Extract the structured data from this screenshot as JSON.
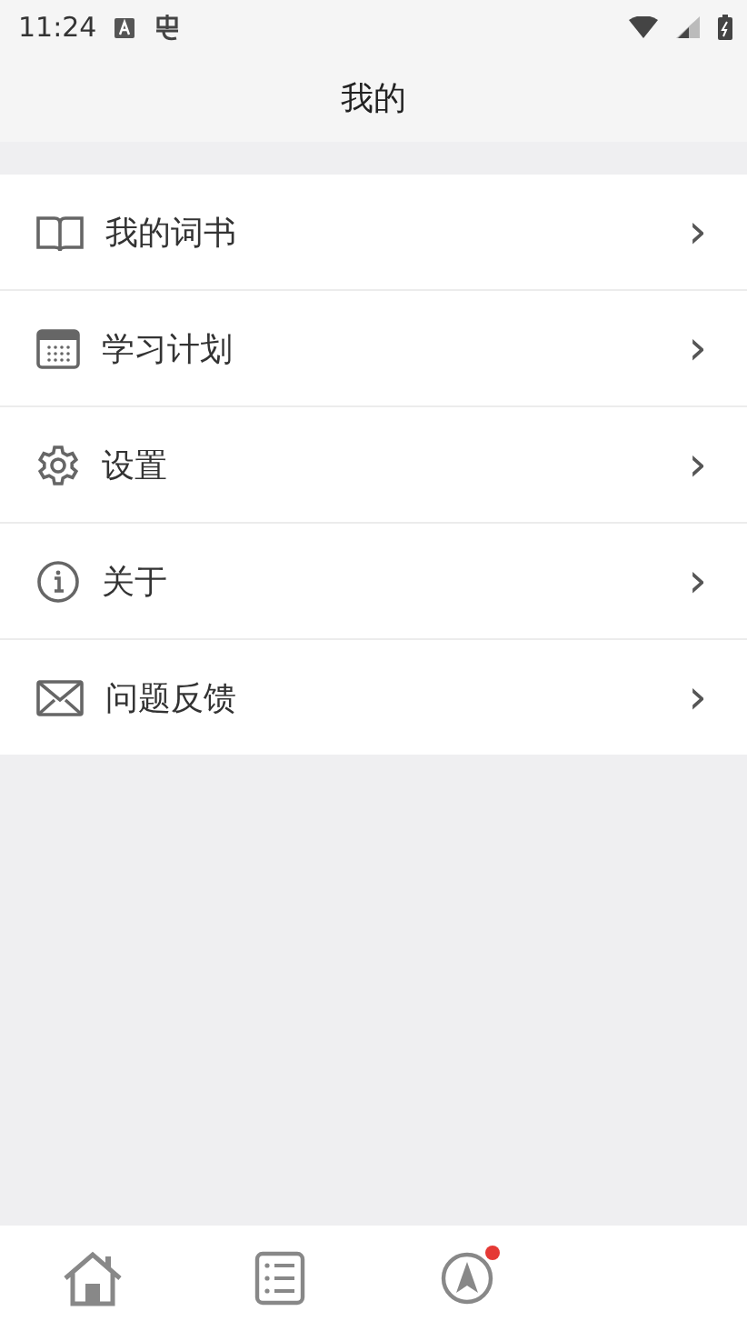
{
  "status_bar": {
    "time": "11:24"
  },
  "header": {
    "title": "我的"
  },
  "menu": [
    {
      "kind": "book",
      "label": "我的词书",
      "chevron": "›"
    },
    {
      "kind": "calendar",
      "label": "学习计划",
      "chevron": "›"
    },
    {
      "kind": "gear",
      "label": "设置",
      "chevron": "›"
    },
    {
      "kind": "info",
      "label": "关于",
      "chevron": "›"
    },
    {
      "kind": "mail",
      "label": "问题反馈",
      "chevron": "›"
    }
  ],
  "tab_bar": [
    {
      "kind": "home",
      "dot": false
    },
    {
      "kind": "list",
      "dot": false
    },
    {
      "kind": "compass",
      "dot": true
    }
  ]
}
